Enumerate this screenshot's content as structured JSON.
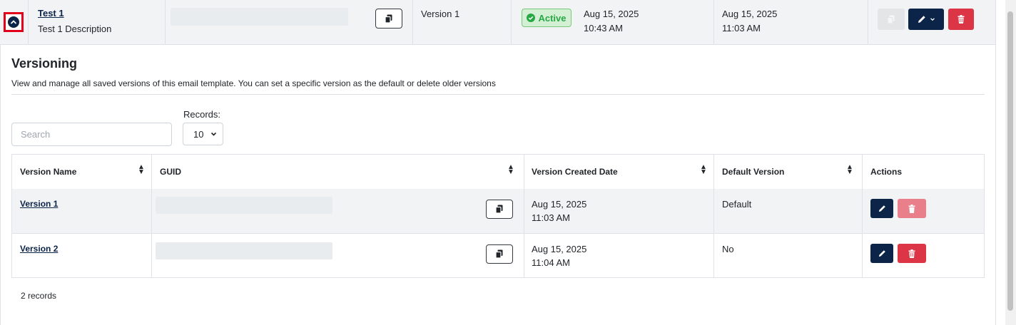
{
  "parent": {
    "name": "Test 1",
    "description": "Test 1 Description",
    "version": "Version 1",
    "status": "Active",
    "created_date": "Aug 15, 2025",
    "created_time": "10:43 AM",
    "modified_date": "Aug 15, 2025",
    "modified_time": "11:03 AM"
  },
  "versioning": {
    "title": "Versioning",
    "description": "View and manage all saved versions of this email template. You can set a specific version as the default or delete older versions",
    "search_placeholder": "Search",
    "records_label": "Records:",
    "records_value": "10",
    "columns": [
      "Version Name",
      "GUID",
      "Version Created Date",
      "Default Version",
      "Actions"
    ],
    "rows": [
      {
        "name": "Version 1",
        "date": "Aug 15, 2025",
        "time": "11:03 AM",
        "default": "Default"
      },
      {
        "name": "Version 2",
        "date": "Aug 15, 2025",
        "time": "11:04 AM",
        "default": "No"
      }
    ],
    "footer": "2 records"
  },
  "colors": {
    "navy": "#0b2447",
    "red": "#dc3545",
    "active_green": "#28a745",
    "highlight_red": "#e2001a"
  }
}
